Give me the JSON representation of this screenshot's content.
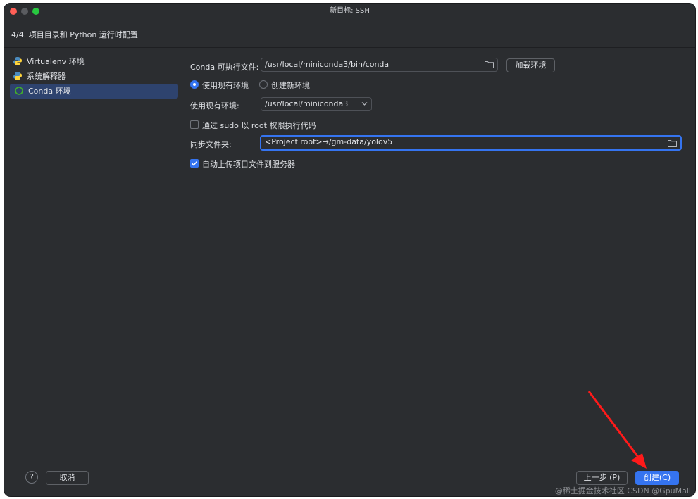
{
  "window": {
    "title": "新目标: SSH"
  },
  "step": {
    "title": "4/4. 项目目录和 Python 运行时配置"
  },
  "sidebar": {
    "items": [
      {
        "label": "Virtualenv 环境",
        "icon": "python-icon",
        "selected": false
      },
      {
        "label": "系统解释器",
        "icon": "python-icon",
        "selected": false
      },
      {
        "label": "Conda 环境",
        "icon": "conda-icon",
        "selected": true
      }
    ]
  },
  "form": {
    "conda_exec_label": "Conda 可执行文件:",
    "conda_exec_value": "/usr/local/miniconda3/bin/conda",
    "load_env_button": "加载环境",
    "radio_existing_label": "使用现有环境",
    "radio_new_label": "创建新环境",
    "existing_env_label": "使用现有环境:",
    "existing_env_value": "/usr/local/miniconda3",
    "sudo_label": "通过 sudo 以 root 权限执行代码",
    "sudo_checked": false,
    "sync_folder_label": "同步文件夹:",
    "sync_folder_value": "<Project root>→/gm-data/yolov5",
    "auto_upload_label": "自动上传项目文件到服务器",
    "auto_upload_checked": true
  },
  "footer": {
    "help_label": "?",
    "cancel_label": "取消",
    "prev_label": "上一步 (P)",
    "create_label": "创建(C)"
  },
  "watermark": {
    "text": "@稀土掘金技术社区 CSDN @GpuMall"
  },
  "colors": {
    "accent": "#3574f0",
    "background": "#2b2d30",
    "selection": "#2e436e",
    "annotation_arrow": "#ff1a1a"
  }
}
